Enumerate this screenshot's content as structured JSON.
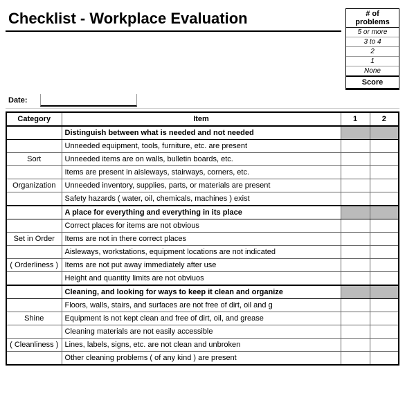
{
  "title": "Checklist - Workplace Evaluation",
  "dateLabel": "Date:",
  "dateValue": "",
  "problemsHeader": "# of problems",
  "problemLevels": [
    "5 or more",
    "3 to 4",
    "2",
    "1",
    "None"
  ],
  "scoreHeader": "Score",
  "columns": {
    "category": "Category",
    "item": "Item",
    "s1": "1",
    "s2": "2"
  },
  "sections": [
    {
      "header": "Distinguish between what is needed and not needed",
      "catLabels": [
        "",
        "",
        "Sort",
        "",
        "Organization",
        ""
      ],
      "items": [
        "Unneeded equipment, tools, furniture, etc. are present",
        "Unneeded items are on walls, bulletin boards, etc.",
        "Items are present in aisleways, stairways, corners, etc.",
        "Unneeded inventory, supplies, parts, or materials are present",
        "Safety hazards ( water, oil, chemicals, machines ) exist"
      ]
    },
    {
      "header": "A place for everything and everything in its place",
      "catLabels": [
        "",
        "",
        "Set in Order",
        "",
        "( Orderliness )",
        ""
      ],
      "items": [
        "Correct places for items are not obvious",
        "Items are not in there correct places",
        "Aisleways, workstations, equipment locations are not indicated",
        "Items are not put away immediately after use",
        "Height and quantity limits are not obviuos"
      ]
    },
    {
      "header": "Cleaning, and looking for ways to keep it clean and organize",
      "catLabels": [
        "",
        "",
        "Shine",
        "",
        "( Cleanliness )",
        ""
      ],
      "items": [
        "Floors, walls, stairs, and surfaces are not free of dirt, oil and g",
        "Equipment is not kept clean and free of dirt, oil, and grease",
        "Cleaning materials are not easily accessible",
        "Lines, labels, signs, etc. are not clean and unbroken",
        "Other cleaning problems ( of any kind ) are present"
      ]
    }
  ]
}
